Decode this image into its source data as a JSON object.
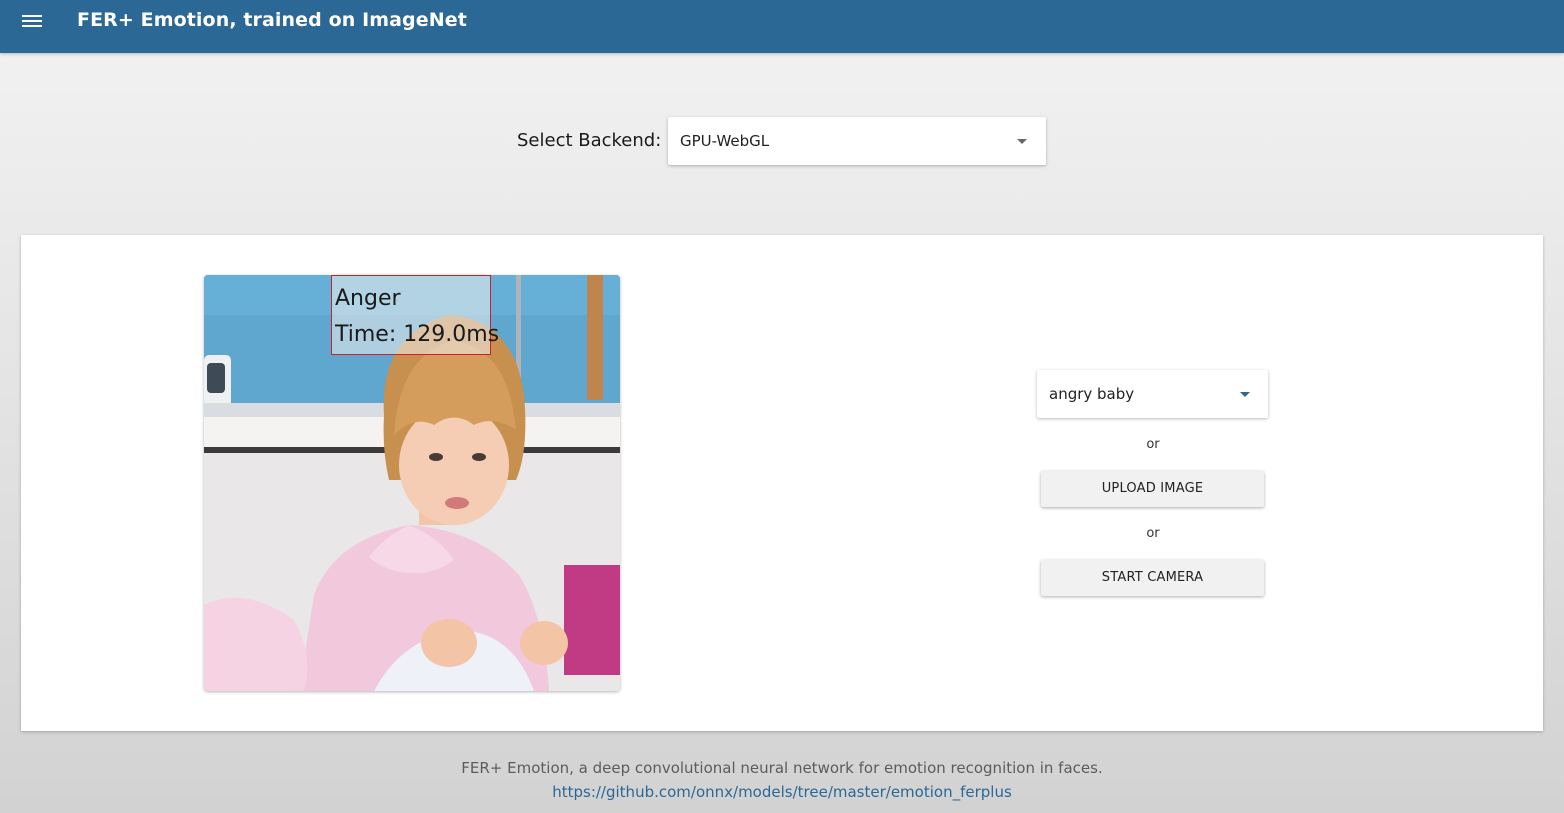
{
  "app": {
    "title": "FER+ Emotion, trained on ImageNet"
  },
  "backend": {
    "label": "Select Backend:",
    "selected": "GPU-WebGL"
  },
  "image_source": {
    "selected": "angry baby",
    "or_text_1": "or",
    "upload_label": "UPLOAD IMAGE",
    "or_text_2": "or",
    "camera_label": "START CAMERA"
  },
  "detection": {
    "emotion": "Anger",
    "time": "Time: 129.0ms",
    "box_color": "#d01e2a"
  },
  "footer": {
    "description": "FER+ Emotion, a deep convolutional neural network for emotion recognition in faces.",
    "link": "https://github.com/onnx/models/tree/master/emotion_ferplus"
  },
  "colors": {
    "header": "#2b6895",
    "link": "#2b6895"
  },
  "icons": {
    "menu": "hamburger-menu-icon",
    "dropdown": "arrow-drop-down-icon"
  }
}
